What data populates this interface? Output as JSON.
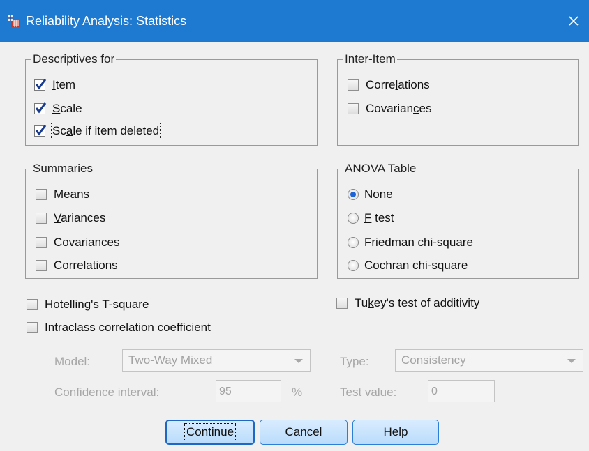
{
  "window": {
    "title": "Reliability Analysis: Statistics",
    "colors": {
      "titlebar": "#1e7ad1",
      "button_border": "#2b7fd6",
      "radio_selected": "#1d63d6"
    }
  },
  "descriptives": {
    "legend": "Descriptives for",
    "item": {
      "pre": "",
      "key": "I",
      "post": "tem",
      "checked": true
    },
    "scale": {
      "pre": "",
      "key": "S",
      "post": "cale",
      "checked": true
    },
    "scale_deleted": {
      "pre": "Sc",
      "key": "a",
      "post": "le if item deleted",
      "checked": true
    }
  },
  "inter_item": {
    "legend": "Inter-Item",
    "correlations": {
      "pre": "Corre",
      "key": "l",
      "post": "ations",
      "checked": false
    },
    "covariances": {
      "pre": "Covarian",
      "key": "c",
      "post": "es",
      "checked": false
    }
  },
  "summaries": {
    "legend": "Summaries",
    "means": {
      "pre": "",
      "key": "M",
      "post": "eans",
      "checked": false
    },
    "variances": {
      "pre": "",
      "key": "V",
      "post": "ariances",
      "checked": false
    },
    "covariances": {
      "pre": "C",
      "key": "o",
      "post": "variances",
      "checked": false
    },
    "correlations": {
      "pre": "Co",
      "key": "r",
      "post": "relations",
      "checked": false
    }
  },
  "anova": {
    "legend": "ANOVA Table",
    "none": {
      "pre": "",
      "key": "N",
      "post": "one",
      "selected": true
    },
    "f_test": {
      "pre": "",
      "key": "F",
      "post": " test",
      "selected": false
    },
    "friedman": {
      "pre": "Friedman chi-s",
      "key": "q",
      "post": "uare",
      "selected": false
    },
    "cochran": {
      "pre": "Coc",
      "key": "h",
      "post": "ran chi-square",
      "selected": false
    }
  },
  "options": {
    "hotelling": {
      "pre": "Hotellin",
      "key": "g",
      "post": "'s T-square",
      "checked": false
    },
    "tukey": {
      "pre": "Tu",
      "key": "k",
      "post": "ey's test of additivity",
      "checked": false
    },
    "intraclass": {
      "pre": "In",
      "key": "t",
      "post": "raclass correlation coefficient",
      "checked": false
    }
  },
  "icc": {
    "model_label": "Model:",
    "model_value": "Two-Way Mixed",
    "type_label": "Type:",
    "type_value": "Consistency",
    "ci_pre": "",
    "ci_key": "C",
    "ci_post": "onfidence interval:",
    "ci_value": "95",
    "ci_unit": "%",
    "test_pre": "Test val",
    "test_key": "u",
    "test_post": "e:",
    "test_value": "0"
  },
  "buttons": {
    "continue": "Continue",
    "cancel": "Cancel",
    "help": "Help"
  }
}
